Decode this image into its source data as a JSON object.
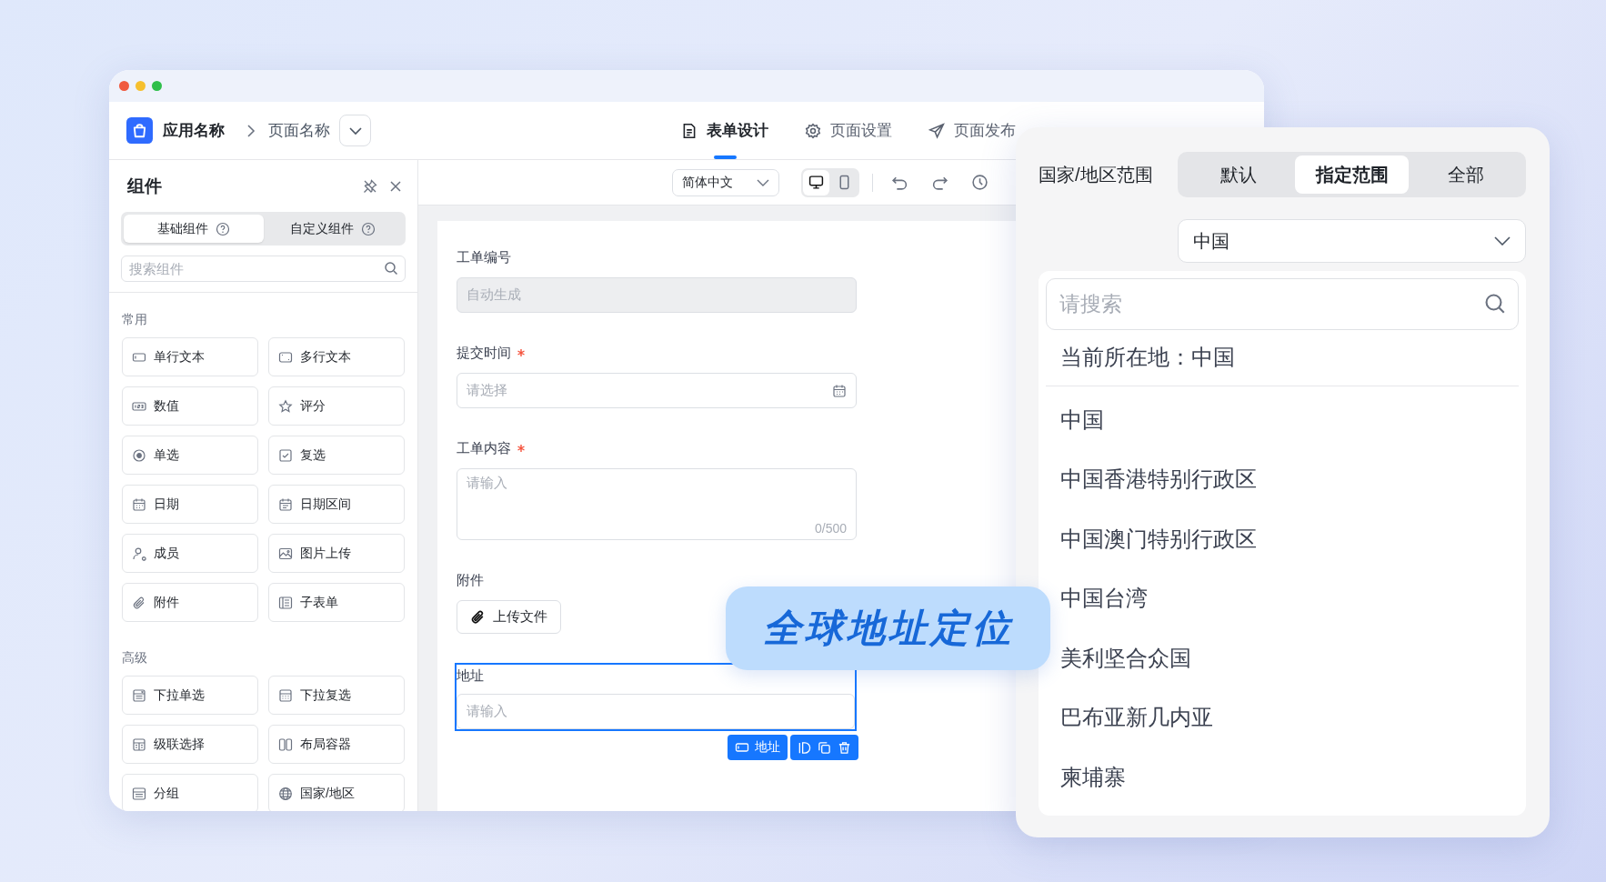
{
  "window": {
    "app_name": "应用名称",
    "page_name": "页面名称"
  },
  "tabs": [
    {
      "label": "表单设计",
      "selected": true
    },
    {
      "label": "页面设置",
      "selected": false
    },
    {
      "label": "页面发布",
      "selected": false
    }
  ],
  "toolbar": {
    "language": "简体中文",
    "view_modes": [
      {
        "selected": true
      },
      {
        "selected": false
      }
    ]
  },
  "panel": {
    "title": "组件",
    "tabs": [
      {
        "label": "基础组件",
        "selected": true
      },
      {
        "label": "自定义组件",
        "selected": false
      }
    ],
    "search": {
      "placeholder": "搜索组件"
    },
    "groups": [
      {
        "title": "常用",
        "items": [
          {
            "label": "单行文本",
            "kind": "text"
          },
          {
            "label": "多行文本",
            "kind": "textarea"
          },
          {
            "label": "数值",
            "kind": "number"
          },
          {
            "label": "评分",
            "kind": "rating"
          },
          {
            "label": "单选",
            "kind": "radio"
          },
          {
            "label": "复选",
            "kind": "checkbox"
          },
          {
            "label": "日期",
            "kind": "date"
          },
          {
            "label": "日期区间",
            "kind": "daterange"
          },
          {
            "label": "成员",
            "kind": "member"
          },
          {
            "label": "图片上传",
            "kind": "image"
          },
          {
            "label": "附件",
            "kind": "attachment"
          },
          {
            "label": "子表单",
            "kind": "subform"
          }
        ]
      },
      {
        "title": "高级",
        "items": [
          {
            "label": "下拉单选",
            "kind": "select"
          },
          {
            "label": "下拉复选",
            "kind": "multiselect"
          },
          {
            "label": "级联选择",
            "kind": "cascader"
          },
          {
            "label": "布局容器",
            "kind": "layout"
          },
          {
            "label": "分组",
            "kind": "group"
          },
          {
            "label": "国家/地区",
            "kind": "region"
          }
        ]
      }
    ]
  },
  "form": {
    "fields": [
      {
        "label": "工单编号",
        "required": false,
        "kind": "readonly",
        "placeholder": "自动生成",
        "selected": false
      },
      {
        "label": "提交时间",
        "required": true,
        "kind": "date",
        "placeholder": "请选择",
        "selected": false
      },
      {
        "label": "工单内容",
        "required": true,
        "kind": "textarea",
        "placeholder": "请输入",
        "counter": "0/500",
        "selected": false
      },
      {
        "label": "附件",
        "required": false,
        "kind": "upload",
        "button": "上传文件",
        "selected": false
      },
      {
        "label": "地址",
        "required": false,
        "kind": "text",
        "placeholder": "请输入",
        "selected": true,
        "chip": "地址"
      }
    ]
  },
  "badge": {
    "text": "全球地址定位"
  },
  "region_panel": {
    "label": "国家/地区范围",
    "options": [
      {
        "label": "默认",
        "selected": false
      },
      {
        "label": "指定范围",
        "selected": true
      },
      {
        "label": "全部",
        "selected": false
      }
    ],
    "select": {
      "value": "中国"
    },
    "dropdown": {
      "search": {
        "placeholder": "请搜索"
      },
      "current": "当前所在地：中国",
      "items": [
        "中国",
        "中国香港特别行政区",
        "中国澳门特别行政区",
        "中国台湾",
        "美利坚合众国",
        "巴布亚新几内亚",
        "柬埔寨"
      ]
    }
  }
}
